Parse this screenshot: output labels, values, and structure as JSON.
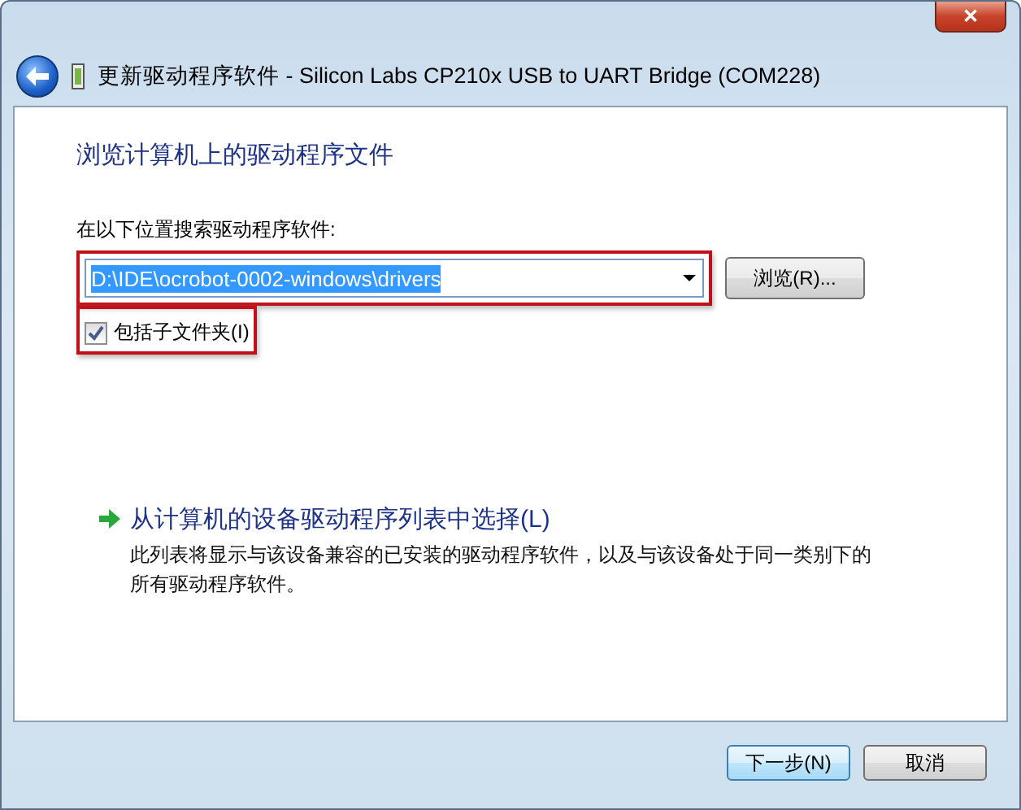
{
  "window": {
    "title": "更新驱动程序软件 - Silicon Labs CP210x USB to UART Bridge (COM228)",
    "close": "✕"
  },
  "heading": "浏览计算机上的驱动程序文件",
  "search": {
    "label": "在以下位置搜索驱动程序软件:",
    "value": "D:\\IDE\\ocrobot-0002-windows\\drivers",
    "highlighted": true,
    "browse": "浏览(R)..."
  },
  "include_subfolders": {
    "label": "包括子文件夹(I)",
    "checked": true,
    "highlighted": true
  },
  "pick_option": {
    "title": "从计算机的设备驱动程序列表中选择(L)",
    "description": "此列表将显示与该设备兼容的已安装的驱动程序软件，以及与该设备处于同一类别下的所有驱动程序软件。"
  },
  "buttons": [
    {
      "label": "下一步(N)",
      "kind": "default"
    },
    {
      "label": "取消",
      "kind": "normal"
    }
  ]
}
